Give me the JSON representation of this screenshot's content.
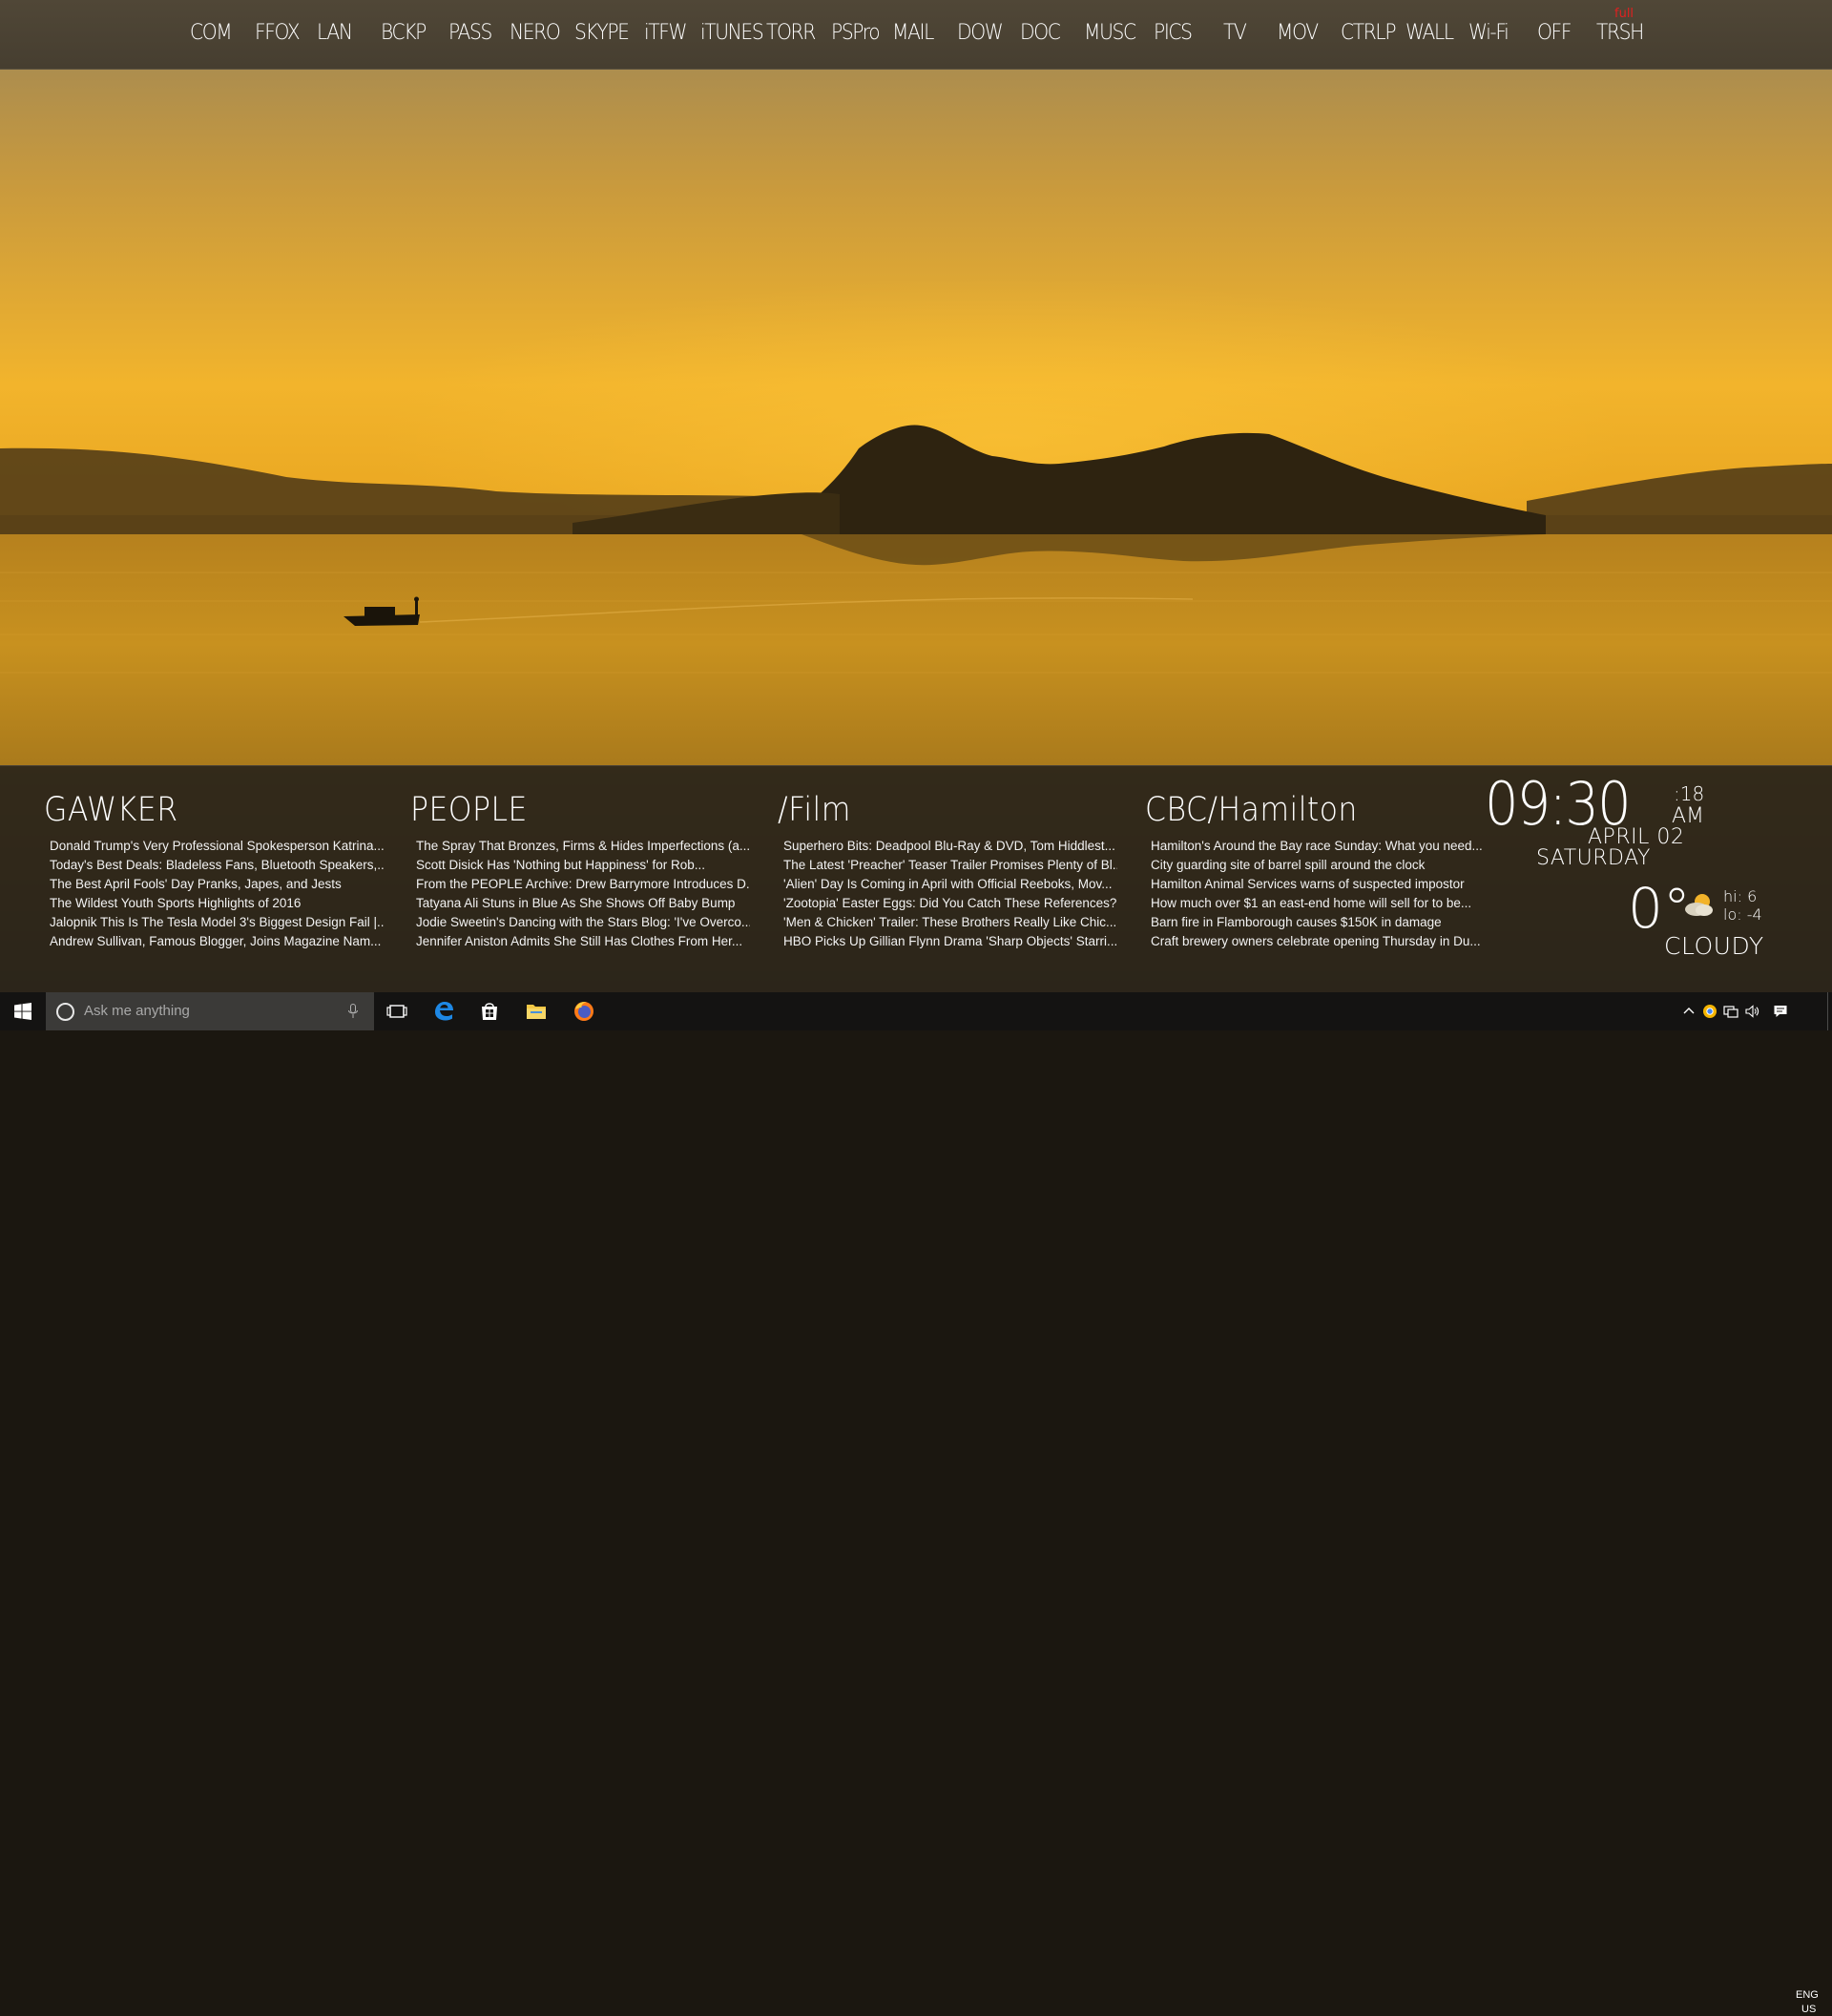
{
  "launcher": {
    "items": [
      "COM",
      "FFOX",
      "LAN",
      "BCKP",
      "PASS",
      "NERO",
      "SKYPE",
      "iTFW",
      "iTUNES",
      "TORR",
      "PSPro",
      "MAIL",
      "DOW",
      "DOC",
      "MUSC",
      "PICS",
      "TV",
      "MOV",
      "CTRLP",
      "WALL",
      "Wi-Fi",
      "OFF",
      "TRSH"
    ],
    "trash_badge": "full"
  },
  "feeds": [
    {
      "title": "GAWKER",
      "items": [
        "Donald Trump's Very Professional Spokesperson Katrina...",
        "Today's Best Deals: Bladeless Fans, Bluetooth Speakers,...",
        "The Best April Fools' Day Pranks, Japes, and Jests",
        "The Wildest Youth Sports Highlights of 2016",
        "Jalopnik This Is The Tesla Model 3's Biggest Design Fail |...",
        "Andrew Sullivan, Famous Blogger, Joins Magazine Nam..."
      ]
    },
    {
      "title": "PEOPLE",
      "items": [
        "The Spray That Bronzes, Firms & Hides Imperfections (a....",
        "Scott Disick Has 'Nothing but Happiness' for Rob...",
        "From the PEOPLE Archive: Drew Barrymore Introduces D...",
        "Tatyana Ali Stuns in Blue As She Shows Off Baby Bump",
        "Jodie Sweetin's Dancing with the Stars Blog: 'I've Overco...",
        "Jennifer Aniston Admits She Still Has Clothes From Her..."
      ]
    },
    {
      "title": "/Film",
      "items": [
        "Superhero Bits: Deadpool Blu-Ray & DVD, Tom Hiddlest...",
        "The Latest 'Preacher' Teaser Trailer Promises Plenty of Bl...",
        "'Alien' Day Is Coming in April with Official Reeboks, Mov...",
        "'Zootopia' Easter Eggs: Did You Catch These References?",
        "'Men & Chicken' Trailer: These Brothers Really Like Chic...",
        "HBO Picks Up Gillian Flynn Drama 'Sharp Objects' Starri..."
      ]
    },
    {
      "title": "CBC/Hamilton",
      "items": [
        "Hamilton's Around the Bay race Sunday: What you need...",
        "City guarding site of barrel spill around the clock",
        "Hamilton Animal Services warns of suspected impostor",
        "How much over $1 an east-end home will sell for to be...",
        "Barn fire in Flamborough causes $150K in damage",
        "Craft brewery owners celebrate opening Thursday in Du..."
      ]
    }
  ],
  "clock": {
    "time": "09:30",
    "seconds": ":18",
    "ampm": "AM",
    "date": "APRIL 02",
    "day": "SATURDAY"
  },
  "weather": {
    "temp": "0°",
    "hi": "hi: 6",
    "lo": "lo: -4",
    "condition": "CLOUDY",
    "icon": "partly-cloudy-icon"
  },
  "taskbar": {
    "search_placeholder": "Ask me anything",
    "pinned": [
      "task-view-icon",
      "edge-icon",
      "store-icon",
      "file-explorer-icon",
      "firefox-icon"
    ],
    "lang_top": "ENG",
    "lang_bottom": "US"
  },
  "colors": {
    "sky_top": "#a58c5c",
    "sky_horizon": "#f4b52a",
    "panel": "#26211b",
    "trash_badge": "#e02020",
    "taskbar": "#141312"
  }
}
